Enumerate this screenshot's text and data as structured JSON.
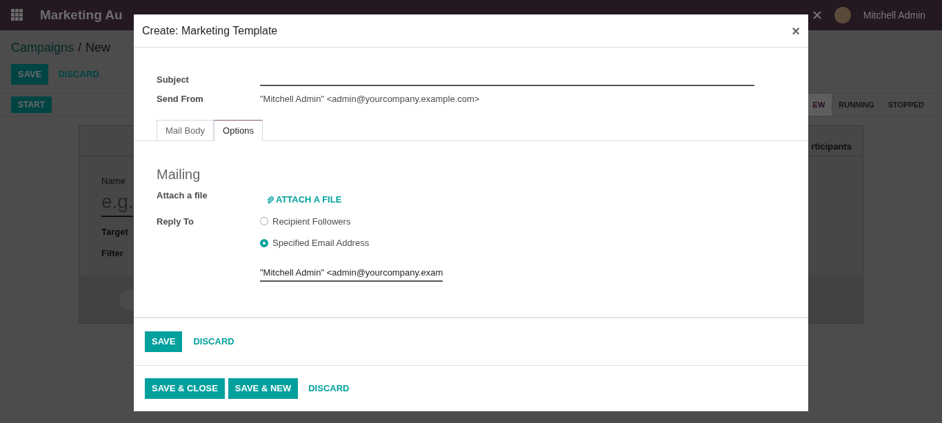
{
  "navbar": {
    "app_title": "Marketing Au",
    "user": "Mitchell Admin"
  },
  "breadcrumb": {
    "parent": "Campaigns",
    "separator": "/",
    "current": "New"
  },
  "form_buttons": [
    "SAVE",
    "DISCARD"
  ],
  "start_button": "START",
  "stages": [
    {
      "label": "EW",
      "selected": true
    },
    {
      "label": "RUNNING",
      "selected": false
    },
    {
      "label": "STOPPED",
      "selected": false
    }
  ],
  "card": {
    "tab": "rticipants",
    "name_label": "Name",
    "name_placeholder": "e.g.",
    "fields": [
      "Target",
      "Filter"
    ]
  },
  "dialog": {
    "title": "Create: Marketing Template",
    "close": "×",
    "fields": [
      {
        "label": "Subject",
        "kind": "input"
      },
      {
        "label": "Send From",
        "kind": "text",
        "value": "\"Mitchell Admin\" <admin@yourcompany.example.com>"
      }
    ],
    "tabs": [
      {
        "label": "Mail Body",
        "selected": false
      },
      {
        "label": "Options",
        "selected": true
      }
    ],
    "section": "Mailing",
    "attach_label": "Attach a file",
    "attach_link": "ATTACH A FILE",
    "reply_label": "Reply To",
    "reply_options": [
      {
        "label": "Recipient Followers",
        "selected": false
      },
      {
        "label": "Specified Email Address",
        "selected": true
      }
    ],
    "reply_value": "\"Mitchell Admin\" <admin@yourcompany.exam",
    "inner_buttons": [
      {
        "label": "SAVE",
        "kind": "primary"
      },
      {
        "label": "DISCARD",
        "kind": "link"
      }
    ],
    "footer_buttons": [
      {
        "label": "SAVE & CLOSE",
        "kind": "primary"
      },
      {
        "label": "SAVE & NEW",
        "kind": "primary"
      },
      {
        "label": "DISCARD",
        "kind": "link"
      }
    ]
  }
}
